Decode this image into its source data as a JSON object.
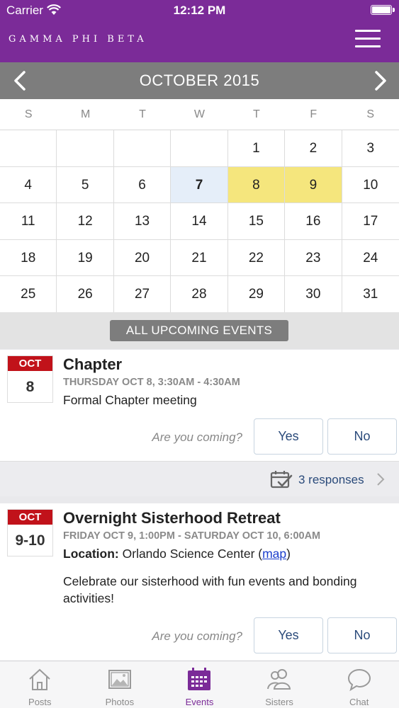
{
  "status_bar": {
    "carrier": "Carrier",
    "time": "12:12 PM"
  },
  "header": {
    "brand": "GAMMA PHI BETA"
  },
  "calendar": {
    "month_title": "OCTOBER 2015",
    "weekdays": [
      "S",
      "M",
      "T",
      "W",
      "T",
      "F",
      "S"
    ],
    "days": [
      "",
      "",
      "",
      "",
      "1",
      "2",
      "3",
      "4",
      "5",
      "6",
      "7",
      "8",
      "9",
      "10",
      "11",
      "12",
      "13",
      "14",
      "15",
      "16",
      "17",
      "18",
      "19",
      "20",
      "21",
      "22",
      "23",
      "24",
      "25",
      "26",
      "27",
      "28",
      "29",
      "30",
      "31"
    ],
    "today": "7",
    "event_days": [
      "8",
      "9"
    ]
  },
  "section": {
    "title": "ALL UPCOMING EVENTS"
  },
  "events": [
    {
      "badge_month": "OCT",
      "badge_day": "8",
      "title": "Chapter",
      "when": "THURSDAY OCT 8, 3:30AM - 4:30AM",
      "description": "Formal Chapter meeting",
      "prompt": "Are you coming?",
      "yes_label": "Yes",
      "no_label": "No",
      "responses": "3 responses"
    },
    {
      "badge_month": "OCT",
      "badge_day": "9-10",
      "title": "Overnight Sisterhood Retreat",
      "when": "FRIDAY OCT 9, 1:00PM - SATURDAY OCT 10, 6:00AM",
      "location_label": "Location:",
      "location": "Orlando Science Center",
      "map_link": "map",
      "description": "Celebrate our sisterhood with fun events and bonding activities!",
      "prompt": "Are you coming?",
      "yes_label": "Yes",
      "no_label": "No"
    }
  ],
  "tabbar": {
    "tabs": [
      {
        "label": "Posts",
        "icon": "house-icon"
      },
      {
        "label": "Photos",
        "icon": "photo-icon"
      },
      {
        "label": "Events",
        "icon": "calendar-icon"
      },
      {
        "label": "Sisters",
        "icon": "people-icon"
      },
      {
        "label": "Chat",
        "icon": "chat-bubble-icon"
      }
    ],
    "active": "Events"
  },
  "colors": {
    "brand_purple": "#7b2b98",
    "month_bar_gray": "#7d7d7d",
    "event_day_yellow": "#f5e67d",
    "today_blue": "#e5eef9",
    "badge_red": "#c1121a"
  }
}
